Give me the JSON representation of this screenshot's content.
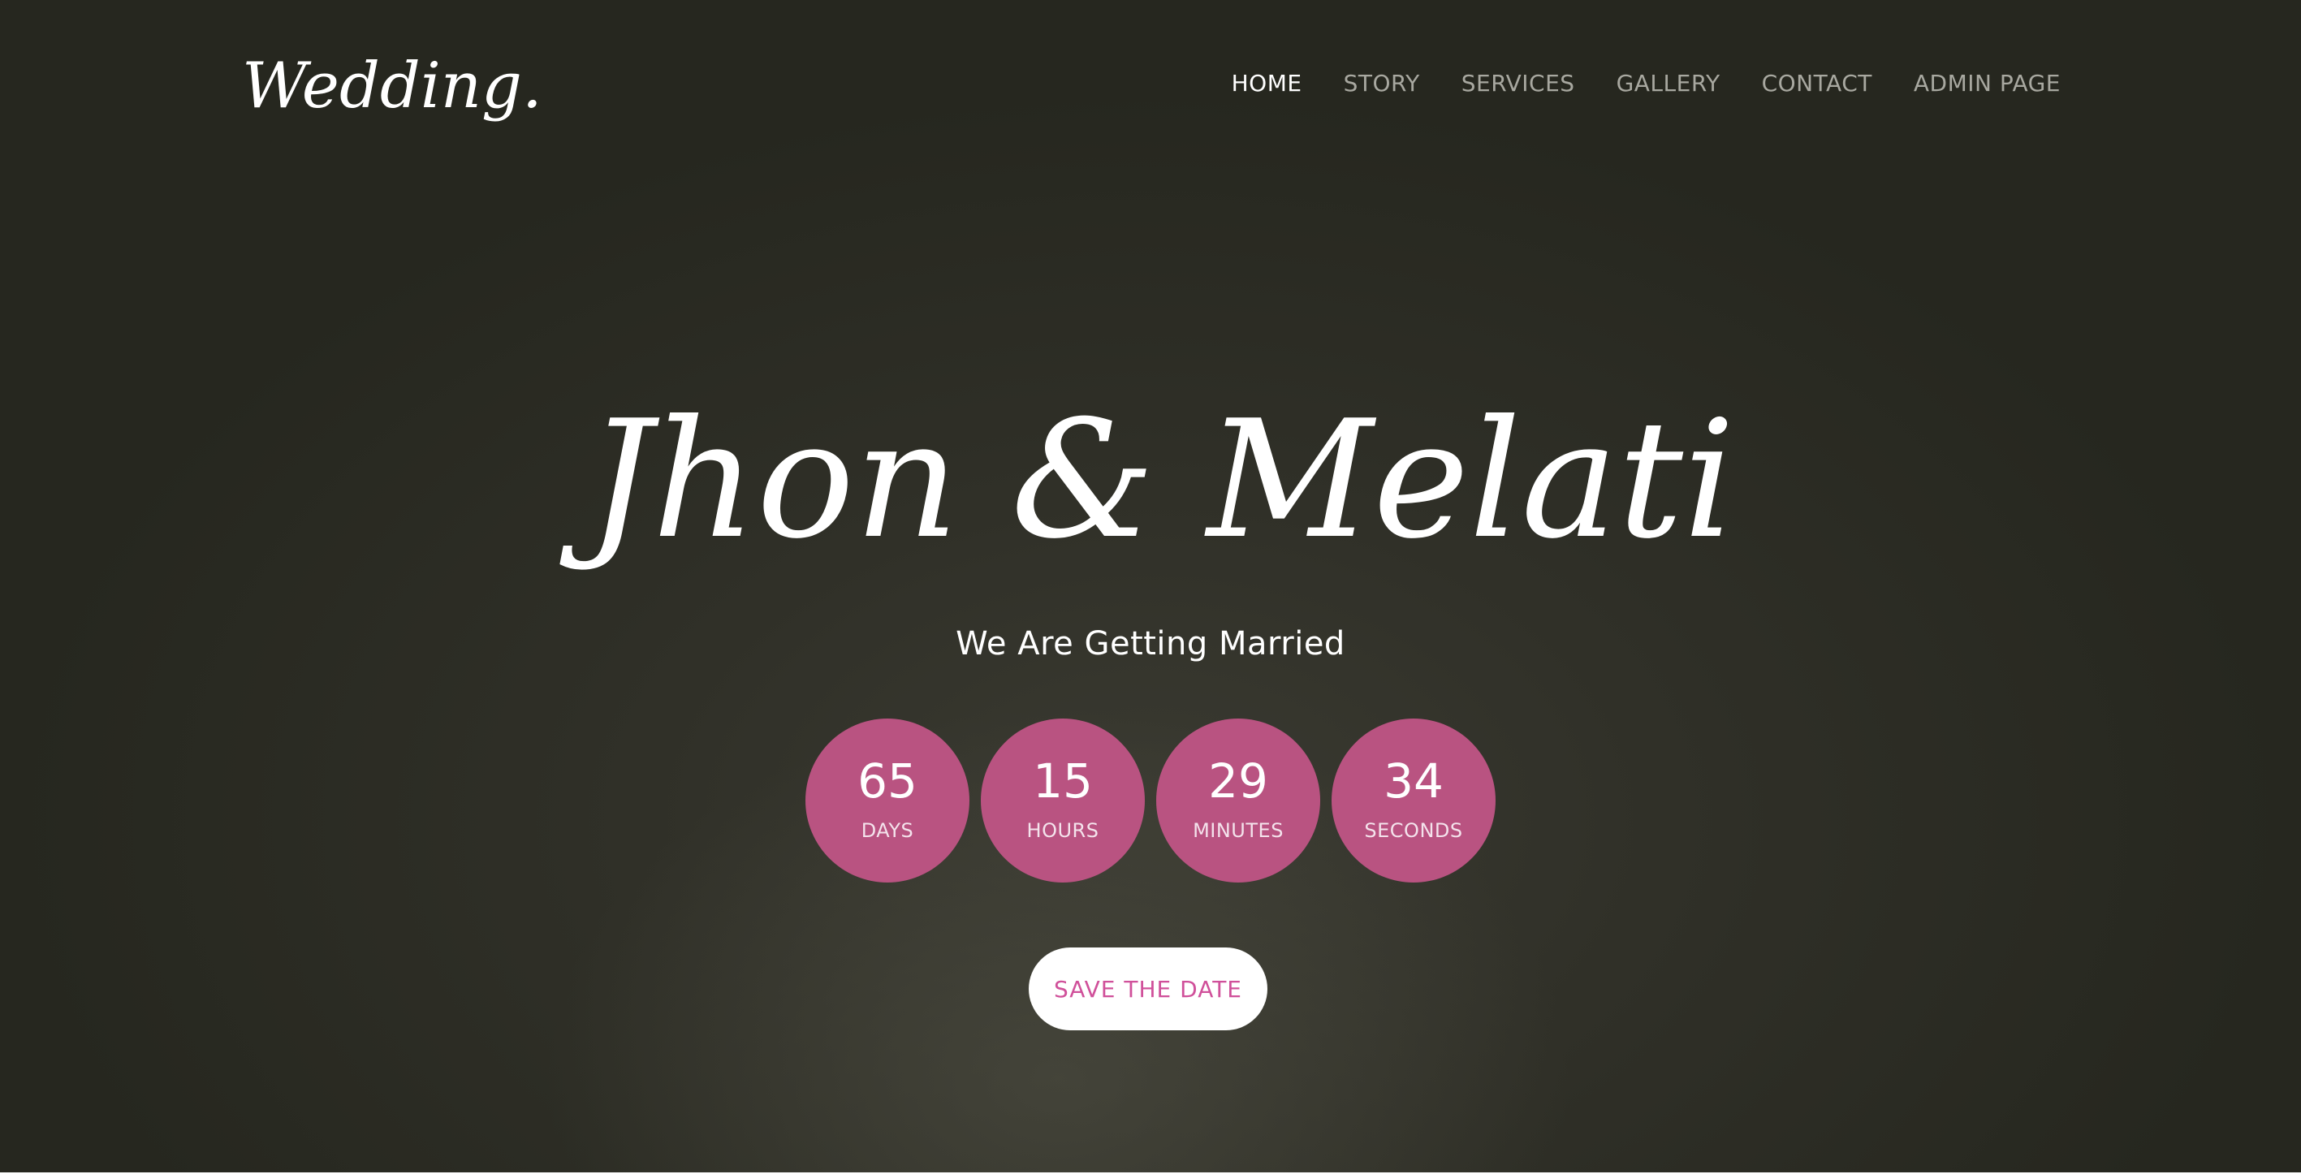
{
  "header": {
    "logo_text": "Wedding.",
    "nav": [
      {
        "label": "HOME",
        "active": true
      },
      {
        "label": "STORY",
        "active": false
      },
      {
        "label": "SERVICES",
        "active": false
      },
      {
        "label": "GALLERY",
        "active": false
      },
      {
        "label": "CONTACT",
        "active": false
      },
      {
        "label": "ADMIN PAGE",
        "active": false
      }
    ]
  },
  "hero": {
    "names": "Jhon & Melati",
    "subtitle": "We Are Getting Married",
    "countdown": [
      {
        "value": "65",
        "label": "DAYS"
      },
      {
        "value": "15",
        "label": "HOURS"
      },
      {
        "value": "29",
        "label": "MINUTES"
      },
      {
        "value": "34",
        "label": "SECONDS"
      }
    ],
    "cta_label": "SAVE THE DATE"
  },
  "colors": {
    "accent": "#b95381",
    "cta_text": "#d0509a",
    "background_dark": "#2c2d25",
    "nav_inactive": "#a8a8a0",
    "nav_active": "#ffffff"
  }
}
